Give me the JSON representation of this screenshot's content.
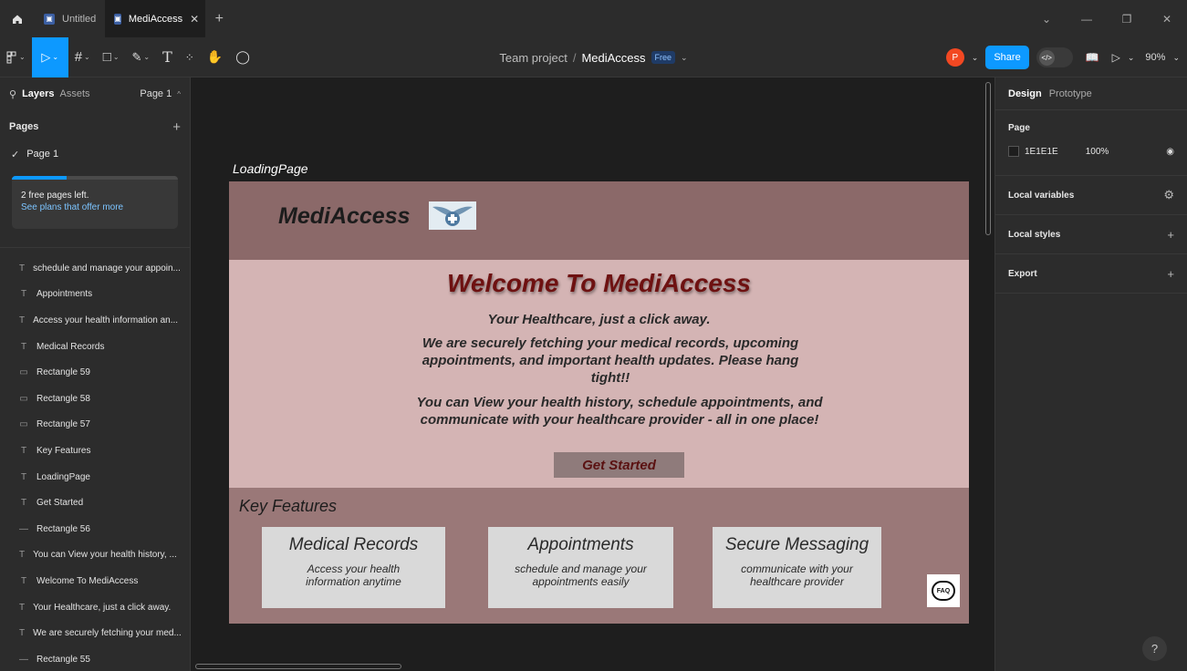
{
  "tabs": [
    {
      "label": "Untitled",
      "active": false
    },
    {
      "label": "MediAccess",
      "active": true
    }
  ],
  "toolbar": {
    "breadcrumb_team": "Team project",
    "breadcrumb_sep": "/",
    "breadcrumb_project": "MediAccess",
    "plan_badge": "Free",
    "avatar_initial": "P",
    "share_label": "Share",
    "zoom": "90%"
  },
  "left_panel": {
    "tab_layers": "Layers",
    "tab_assets": "Assets",
    "page_selector": "Page 1",
    "pages_title": "Pages",
    "current_page": "Page 1",
    "banner_line1": "2 free pages left.",
    "banner_line2": "See plans that offer more",
    "banner_progress": 0.33,
    "layers": [
      {
        "type": "text",
        "name": "schedule and manage your appoin..."
      },
      {
        "type": "text",
        "name": "Appointments"
      },
      {
        "type": "text",
        "name": "Access your health information an..."
      },
      {
        "type": "text",
        "name": "Medical Records"
      },
      {
        "type": "rect",
        "name": "Rectangle 59"
      },
      {
        "type": "rect",
        "name": "Rectangle 58"
      },
      {
        "type": "rect",
        "name": "Rectangle 57"
      },
      {
        "type": "text",
        "name": "Key Features"
      },
      {
        "type": "text",
        "name": "LoadingPage"
      },
      {
        "type": "text",
        "name": "Get Started"
      },
      {
        "type": "line",
        "name": "Rectangle 56"
      },
      {
        "type": "text",
        "name": "You can View your health history, ..."
      },
      {
        "type": "text",
        "name": "Welcome To MediAccess"
      },
      {
        "type": "text",
        "name": "Your Healthcare, just a click away."
      },
      {
        "type": "text",
        "name": "We are securely fetching your med..."
      },
      {
        "type": "line",
        "name": "Rectangle 55"
      }
    ]
  },
  "frame": {
    "label": "LoadingPage",
    "brand": "MediAccess",
    "hero_title": "Welcome To MediAccess",
    "hero_subtitle": "Your Healthcare, just a click away.",
    "hero_para1": "We are securely fetching your medical records, upcoming appointments, and important health updates. Please hang tight!!",
    "hero_para2": "You can View your health history, schedule appointments, and communicate with your healthcare provider - all in one place!",
    "cta_label": "Get Started",
    "features_title": "Key Features",
    "cards": [
      {
        "title": "Medical Records",
        "desc": "Access your health information anytime"
      },
      {
        "title": "Appointments",
        "desc": "schedule and manage your appointments easily"
      },
      {
        "title": "Secure Messaging",
        "desc": "communicate with your healthcare provider"
      }
    ],
    "faq_label": "FAQ",
    "colors": {
      "header": "#8b6969",
      "hero": "#d4b4b4",
      "features": "#9a7878",
      "title": "#6e1111"
    }
  },
  "right_panel": {
    "tab_design": "Design",
    "tab_prototype": "Prototype",
    "page_title": "Page",
    "bg_hex": "1E1E1E",
    "bg_opacity": "100%",
    "local_variables": "Local variables",
    "local_styles": "Local styles",
    "export": "Export"
  },
  "help_label": "?"
}
